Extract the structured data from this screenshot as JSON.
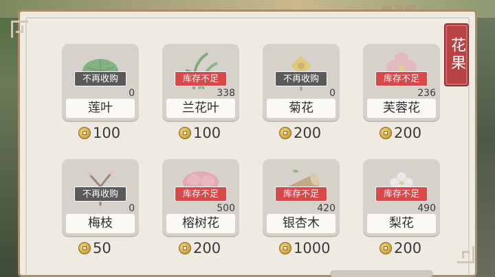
{
  "header": {
    "title": "宝贝阁"
  },
  "side_tab": {
    "label": "花果"
  },
  "items": [
    {
      "name": "莲叶",
      "status": "不再收购",
      "status_color": "#5a5a5a",
      "stock": "0",
      "price": "100",
      "icon": "lotus-leaf-icon"
    },
    {
      "name": "兰花叶",
      "status": "库存不足",
      "status_color": "#d84a4a",
      "stock": "338",
      "price": "100",
      "icon": "orchid-leaf-icon"
    },
    {
      "name": "菊花",
      "status": "不再收购",
      "status_color": "#5a5a5a",
      "stock": "0",
      "price": "200",
      "icon": "chrysanthemum-icon"
    },
    {
      "name": "芙蓉花",
      "status": "库存不足",
      "status_color": "#d84a4a",
      "stock": "236",
      "price": "200",
      "icon": "hibiscus-icon"
    },
    {
      "name": "梅枝",
      "status": "不再收购",
      "status_color": "#5a5a5a",
      "stock": "0",
      "price": "50",
      "icon": "plum-branch-icon"
    },
    {
      "name": "榕树花",
      "status": "库存不足",
      "status_color": "#d84a4a",
      "stock": "500",
      "price": "200",
      "icon": "banyan-flower-icon"
    },
    {
      "name": "银杏木",
      "status": "库存不足",
      "status_color": "#d84a4a",
      "stock": "420",
      "price": "1000",
      "icon": "ginkgo-wood-icon"
    },
    {
      "name": "梨花",
      "status": "库存不足",
      "status_color": "#d84a4a",
      "stock": "490",
      "price": "200",
      "icon": "pear-blossom-icon"
    }
  ]
}
